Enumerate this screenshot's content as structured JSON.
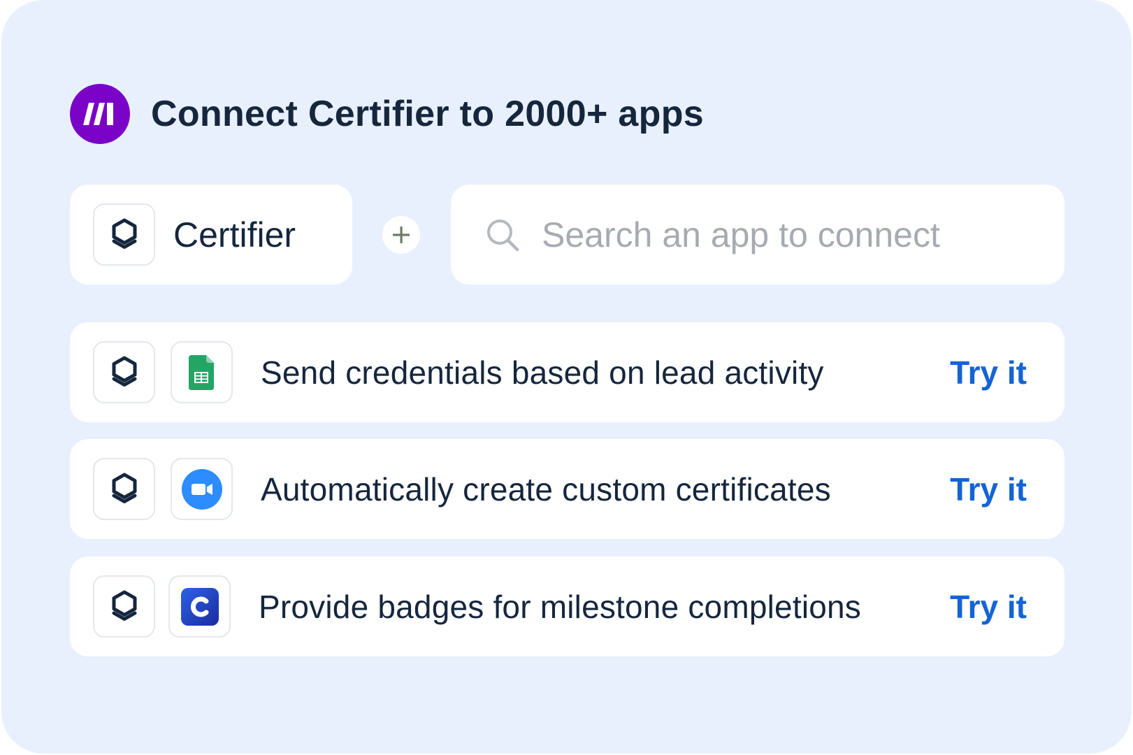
{
  "header": {
    "title": "Connect Certifier to 2000+ apps",
    "logo_icon": "make-logo-icon"
  },
  "selected_app": {
    "name": "Certifier",
    "icon": "certifier-icon"
  },
  "connector": {
    "icon": "plus-icon"
  },
  "search": {
    "placeholder": "Search an app to connect",
    "value": "",
    "icon": "search-icon"
  },
  "templates": [
    {
      "text": "Send credentials based on lead activity",
      "apps": [
        "certifier-icon",
        "google-sheets-icon"
      ],
      "action": "Try it"
    },
    {
      "text": "Automatically create custom certificates",
      "apps": [
        "certifier-icon",
        "zoom-icon"
      ],
      "action": "Try it"
    },
    {
      "text": "Provide badges for milestone completions",
      "apps": [
        "certifier-icon",
        "app-c-icon"
      ],
      "action": "Try it"
    }
  ],
  "colors": {
    "background": "#e8f0fd",
    "brand_purple": "#7b03c7",
    "title": "#15263d",
    "link": "#1464d4",
    "placeholder": "#a7abb1"
  }
}
